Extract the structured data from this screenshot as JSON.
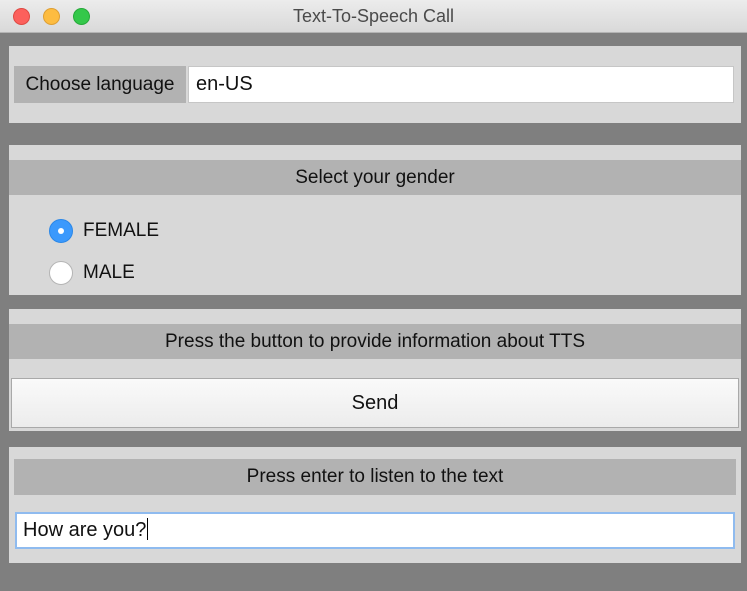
{
  "window": {
    "title": "Text-To-Speech Call"
  },
  "language": {
    "label": "Choose language",
    "value": "en-US"
  },
  "gender": {
    "header": "Select your gender",
    "options": [
      {
        "label": "FEMALE",
        "selected": true
      },
      {
        "label": "MALE",
        "selected": false
      }
    ]
  },
  "tts_info": {
    "header": "Press the button to provide information about TTS",
    "button_label": "Send"
  },
  "listen": {
    "header": "Press enter to listen to the text",
    "text_value": "How are you?"
  },
  "colors": {
    "accent": "#3b99fc",
    "panel": "#d8d8d8",
    "header_bar": "#b2b2b2",
    "window_background": "#7f7f7f"
  }
}
